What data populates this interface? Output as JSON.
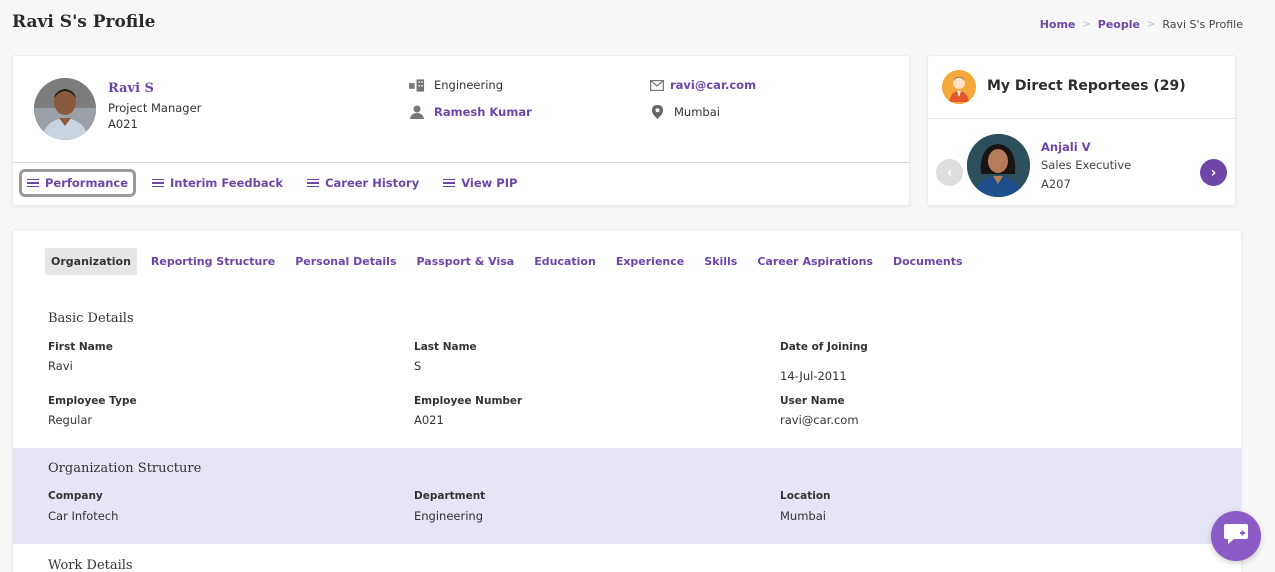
{
  "page": {
    "title": "Ravi S's Profile"
  },
  "breadcrumb": {
    "items": [
      "Home",
      "People"
    ],
    "current": "Ravi S's Profile",
    "separator": ">"
  },
  "profile": {
    "name": "Ravi S",
    "role": "Project Manager",
    "code": "A021",
    "department": "Engineering",
    "manager": "Ramesh Kumar",
    "email": "ravi@car.com",
    "location": "Mumbai",
    "tabs": [
      {
        "label": "Performance",
        "active": true
      },
      {
        "label": "Interim Feedback"
      },
      {
        "label": "Career History"
      },
      {
        "label": "View PIP"
      }
    ]
  },
  "reportees": {
    "title": "My Direct Reportees (29)",
    "current": {
      "name": "Anjali V",
      "role": "Sales Executive",
      "code": "A207"
    }
  },
  "main": {
    "tabs": [
      {
        "label": "Organization",
        "active": true
      },
      {
        "label": "Reporting Structure"
      },
      {
        "label": "Personal Details"
      },
      {
        "label": "Passport & Visa"
      },
      {
        "label": "Education"
      },
      {
        "label": "Experience"
      },
      {
        "label": "Skills"
      },
      {
        "label": "Career Aspirations"
      },
      {
        "label": "Documents"
      }
    ],
    "basic": {
      "title": "Basic Details",
      "first_name": {
        "label": "First Name",
        "value": "Ravi"
      },
      "last_name": {
        "label": "Last Name",
        "value": "S"
      },
      "doj": {
        "label": "Date of Joining",
        "value": "14-Jul-2011"
      },
      "emp_type": {
        "label": "Employee Type",
        "value": "Regular"
      },
      "emp_num": {
        "label": "Employee Number",
        "value": "A021"
      },
      "user_name": {
        "label": "User Name",
        "value": "ravi@car.com"
      }
    },
    "org": {
      "title": "Organization Structure",
      "company": {
        "label": "Company",
        "value": "Car Infotech"
      },
      "department": {
        "label": "Department",
        "value": "Engineering"
      },
      "location": {
        "label": "Location",
        "value": "Mumbai"
      }
    },
    "work": {
      "title": "Work Details"
    }
  },
  "colors": {
    "accent": "#6e46a8",
    "band": "#e6e5f6",
    "fab": "#8b5bc6"
  }
}
